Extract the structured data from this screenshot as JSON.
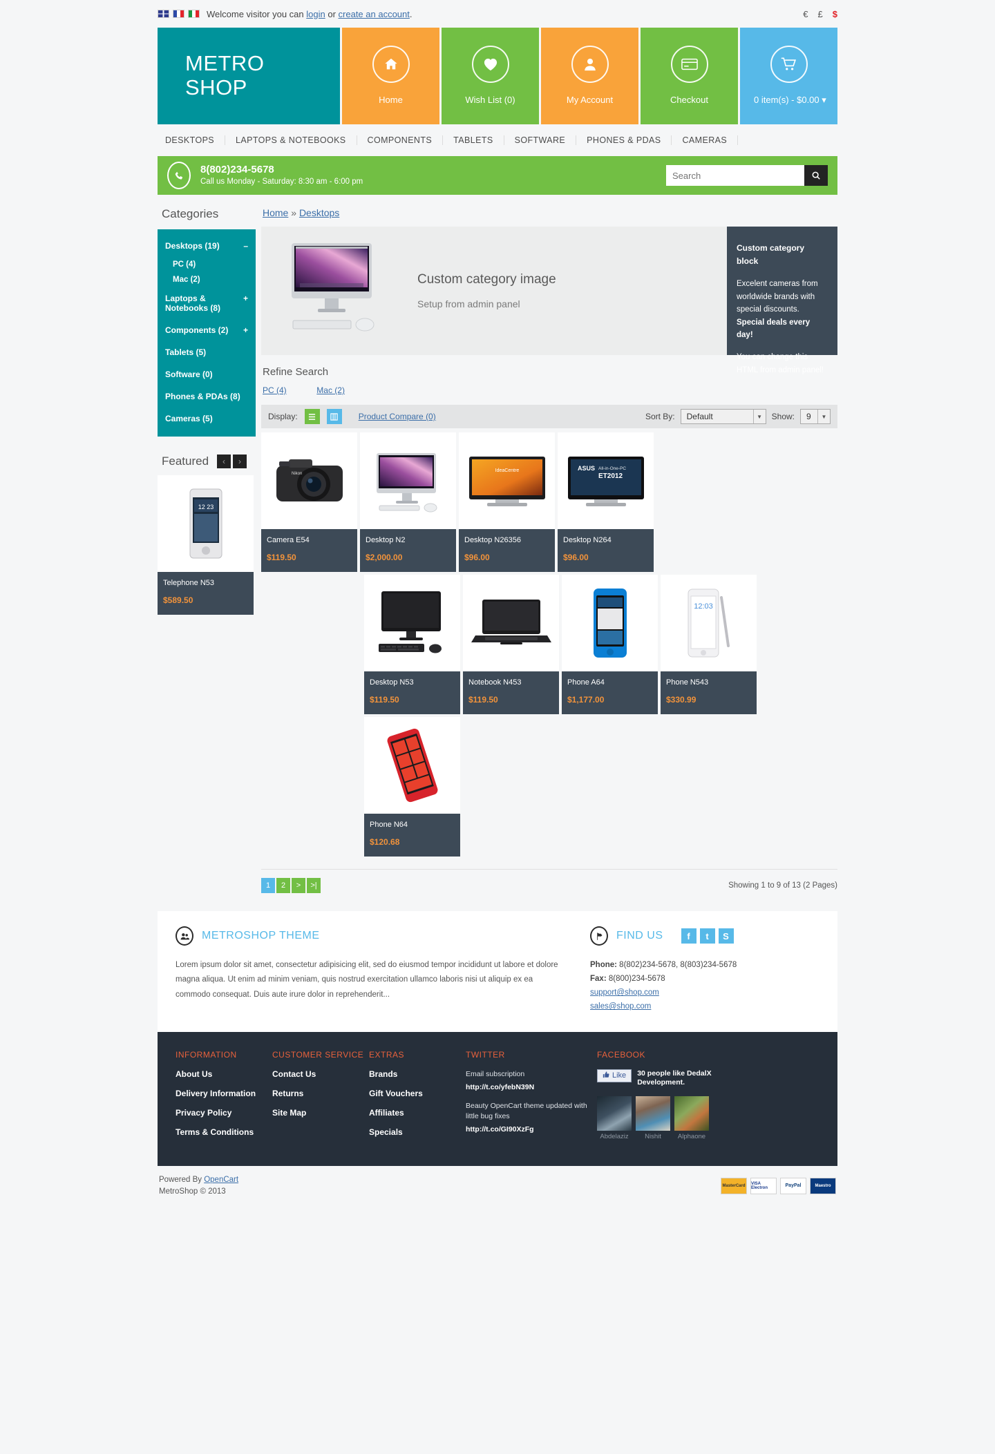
{
  "topbar": {
    "flags": [
      "uk-flag",
      "france-flag",
      "italy-flag"
    ],
    "welcome_prefix": "Welcome visitor you can ",
    "login": "login",
    "or": " or ",
    "create_account": "create an account",
    "period": ".",
    "currencies": [
      "€",
      "£",
      "$"
    ],
    "active_currency": "$"
  },
  "header": {
    "logo_line1": "METRO",
    "logo_line2": "SHOP",
    "tiles": [
      {
        "label": "Home",
        "icon": "home-icon",
        "color": "#f9a33a"
      },
      {
        "label": "Wish List (0)",
        "icon": "heart-icon",
        "color": "#72bf44"
      },
      {
        "label": "My Account",
        "icon": "user-icon",
        "color": "#f9a33a"
      },
      {
        "label": "Checkout",
        "icon": "credit-card-icon",
        "color": "#72bf44"
      },
      {
        "label": "0 item(s) - $0.00 ▾",
        "icon": "cart-icon",
        "color": "#57b9e8"
      }
    ]
  },
  "mainnav": [
    "DESKTOPS",
    "LAPTOPS & NOTEBOOKS",
    "COMPONENTS",
    "TABLETS",
    "SOFTWARE",
    "PHONES & PDAS",
    "CAMERAS"
  ],
  "strip": {
    "phone": "8(802)234-5678",
    "hours": "Call us Monday - Saturday: 8:30 am - 6:00 pm",
    "search_placeholder": "Search",
    "search_value": "",
    "phone_icon": "phone-icon",
    "search_icon": "search-icon"
  },
  "sidebar": {
    "title": "Categories",
    "items": [
      {
        "label": "Desktops (19)",
        "sign": "–",
        "sub": false,
        "active": true
      },
      {
        "label": "PC (4)",
        "sign": "",
        "sub": true
      },
      {
        "label": "Mac (2)",
        "sign": "",
        "sub": true
      },
      {
        "label": "Laptops & Notebooks (8)",
        "sign": "+",
        "sub": false
      },
      {
        "label": "Components (2)",
        "sign": "+",
        "sub": false
      },
      {
        "label": "Tablets (5)",
        "sign": "",
        "sub": false
      },
      {
        "label": "Software (0)",
        "sign": "",
        "sub": false
      },
      {
        "label": "Phones & PDAs (8)",
        "sign": "",
        "sub": false
      },
      {
        "label": "Cameras (5)",
        "sign": "",
        "sub": false
      }
    ],
    "featured_title": "Featured",
    "prev_arrow": "‹",
    "next_arrow": "›"
  },
  "breadcrumb": {
    "home": "Home",
    "sep": " » ",
    "current": "Desktops"
  },
  "category_banner": {
    "heading": "Custom category image",
    "subheading": "Setup from admin panel",
    "image_name": "imac-desktop-image",
    "block_title": "Custom category block",
    "block_p1_a": "Excelent cameras from worldwide brands with special discounts. ",
    "block_p1_b": "Special deals every day!",
    "block_p2": "You can change this HTML from admin panel!"
  },
  "refine": {
    "title": "Refine Search",
    "links": [
      "PC (4)",
      "Mac (2)"
    ]
  },
  "toolbar": {
    "display_label": "Display:",
    "list_icon": "list-view-icon",
    "grid_icon": "grid-view-icon",
    "compare": "Product Compare (0)",
    "sort_label": "Sort By:",
    "sort_value": "Default",
    "show_label": "Show:",
    "show_value": "9"
  },
  "products": [
    {
      "name": "Telephone N53",
      "price": "$589.50",
      "image": "telephone-n53-image"
    },
    {
      "name": "Camera E54",
      "price": "$119.50",
      "image": "camera-e54-image"
    },
    {
      "name": "Desktop N2",
      "price": "$2,000.00",
      "image": "desktop-n2-image"
    },
    {
      "name": "Desktop N26356",
      "price": "$96.00",
      "image": "desktop-n26356-image"
    },
    {
      "name": "Desktop N264",
      "price": "$96.00",
      "image": "desktop-n264-image"
    },
    {
      "name": "Desktop N53",
      "price": "$119.50",
      "image": "desktop-n53-image"
    },
    {
      "name": "Notebook N453",
      "price": "$119.50",
      "image": "notebook-n453-image"
    },
    {
      "name": "Phone A64",
      "price": "$1,177.00",
      "image": "phone-a64-image"
    },
    {
      "name": "Phone N543",
      "price": "$330.99",
      "image": "phone-n543-image"
    },
    {
      "name": "Phone N64",
      "price": "$120.68",
      "image": "phone-n64-image"
    }
  ],
  "pagination": {
    "pages": [
      "1",
      "2",
      ">",
      ">|"
    ],
    "active": "1",
    "showing": "Showing 1 to 9 of 13 (2 Pages)"
  },
  "info_footer": {
    "theme_icon": "users-icon",
    "theme_title": "METROSHOP THEME",
    "theme_body": "Lorem ipsum dolor sit amet, consectetur adipisicing elit, sed do eiusmod tempor incididunt ut labore et dolore magna aliqua. Ut enim ad minim veniam, quis nostrud exercitation ullamco laboris nisi ut aliquip ex ea commodo consequat. Duis aute irure dolor in reprehenderit...",
    "find_icon": "flag-icon",
    "find_title": "FIND US",
    "social": [
      {
        "name": "facebook-icon",
        "glyph": "f"
      },
      {
        "name": "twitter-icon",
        "glyph": "t"
      },
      {
        "name": "skype-icon",
        "glyph": "S"
      }
    ],
    "phone_label": "Phone:",
    "phone_value": " 8(802)234-5678, 8(803)234-5678",
    "fax_label": "Fax:",
    "fax_value": " 8(800)234-5678",
    "email1": "support@shop.com",
    "email2": "sales@shop.com"
  },
  "dark_footer": {
    "columns": [
      {
        "title": "INFORMATION",
        "links": [
          "About Us",
          "Delivery Information",
          "Privacy Policy",
          "Terms & Conditions"
        ]
      },
      {
        "title": "CUSTOMER SERVICE",
        "links": [
          "Contact Us",
          "Returns",
          "Site Map"
        ]
      },
      {
        "title": "EXTRAS",
        "links": [
          "Brands",
          "Gift Vouchers",
          "Affiliates",
          "Specials"
        ]
      }
    ],
    "twitter": {
      "title": "TWITTER",
      "t1": "Email subscription",
      "l1": "http://t.co/yfebN39N",
      "t2": "Beauty OpenCart theme updated with little bug fixes",
      "l2": "http://t.co/GI90XzFg"
    },
    "facebook": {
      "title": "FACEBOOK",
      "like": "Like",
      "like_icon": "thumbs-up-icon",
      "count_text": "30 people like DedalX Development.",
      "faces": [
        {
          "name": "Abdelaziz",
          "image": "face-abdelaziz"
        },
        {
          "name": "Nishit",
          "image": "face-nishit"
        },
        {
          "name": "Alphaone",
          "image": "face-alphaone"
        }
      ]
    }
  },
  "bottom": {
    "powered_prefix": "Powered By ",
    "opencart": "OpenCart",
    "copyright": "MetroShop © 2013",
    "cards": [
      "MasterCard",
      "VISA Electron",
      "PayPal",
      "Maestro"
    ]
  }
}
